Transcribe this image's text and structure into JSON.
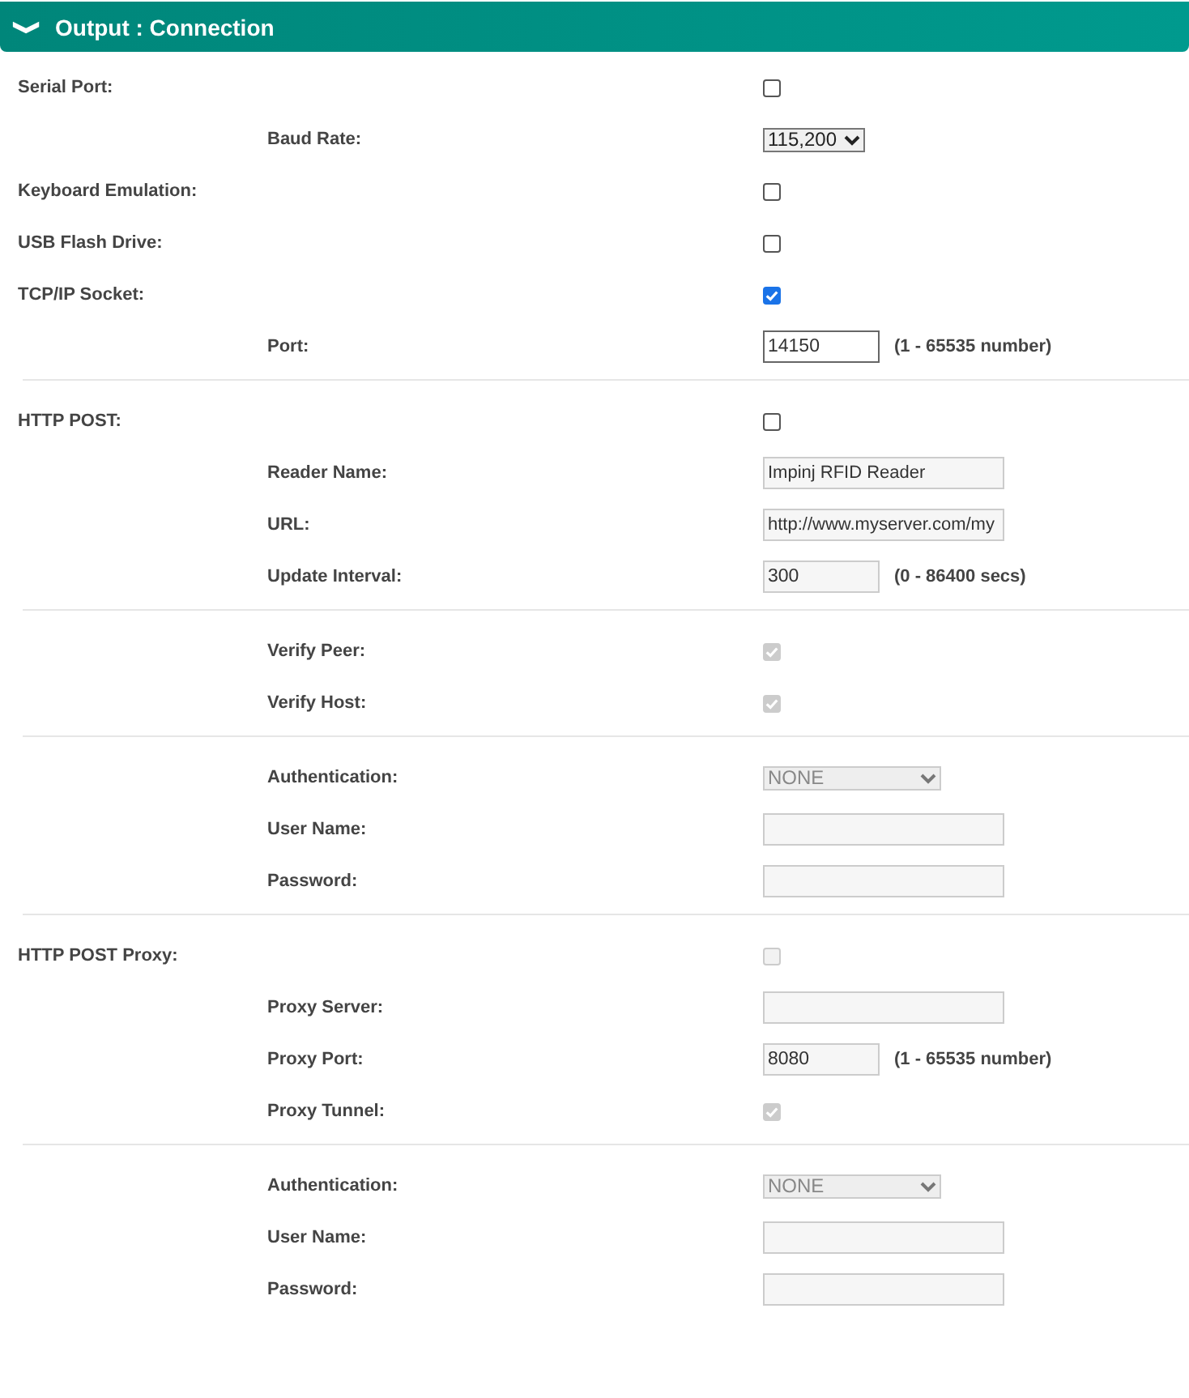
{
  "header": {
    "icon": "❯",
    "title": "Output : Connection",
    "expanded": true
  },
  "groups": [
    {
      "items": [
        {
          "label": "Serial Port:",
          "kind": "checkbox",
          "checked": false,
          "disabled": false,
          "children": [
            {
              "label": "Baud Rate:",
              "kind": "select",
              "value": "115,200",
              "disabled": false
            }
          ]
        },
        {
          "label": "Keyboard Emulation:",
          "kind": "checkbox",
          "checked": false,
          "disabled": false
        },
        {
          "label": "USB Flash Drive:",
          "kind": "checkbox",
          "checked": false,
          "disabled": false
        },
        {
          "label": "TCP/IP Socket:",
          "kind": "checkbox",
          "checked": true,
          "disabled": false,
          "children": [
            {
              "label": "Port:",
              "kind": "number",
              "value": "14150",
              "disabled": false,
              "hint": "(1 - 65535 number)"
            }
          ]
        }
      ]
    },
    {
      "items": [
        {
          "label": "HTTP POST:",
          "kind": "checkbox",
          "checked": false,
          "disabled": false,
          "children": [
            {
              "label": "Reader Name:",
              "kind": "text",
              "value": "Impinj RFID Reader",
              "disabled": true
            },
            {
              "label": "URL:",
              "kind": "text",
              "value": "http://www.myserver.com/my",
              "disabled": true
            },
            {
              "label": "Update Interval:",
              "kind": "number",
              "value": "300",
              "disabled": true,
              "hint": "(0 - 86400 secs)"
            }
          ]
        }
      ]
    },
    {
      "items": [
        {
          "children": [
            {
              "label": "Verify Peer:",
              "kind": "checkbox",
              "checked": true,
              "disabled": true
            },
            {
              "label": "Verify Host:",
              "kind": "checkbox",
              "checked": true,
              "disabled": true
            }
          ]
        }
      ]
    },
    {
      "items": [
        {
          "children": [
            {
              "label": "Authentication:",
              "kind": "select",
              "value": "NONE",
              "disabled": true
            },
            {
              "label": "User Name:",
              "kind": "text",
              "disabled": true
            },
            {
              "label": "Password:",
              "kind": "text",
              "disabled": true
            }
          ]
        }
      ]
    },
    {
      "items": [
        {
          "label": "HTTP POST Proxy:",
          "kind": "checkbox",
          "checked": false,
          "disabled": true,
          "children": [
            {
              "label": "Proxy Server:",
              "kind": "text",
              "disabled": true
            },
            {
              "label": "Proxy Port:",
              "kind": "number",
              "value": "8080",
              "disabled": true,
              "hint": "(1 - 65535 number)"
            },
            {
              "label": "Proxy Tunnel:",
              "kind": "checkbox",
              "checked": true,
              "disabled": true
            }
          ]
        }
      ]
    },
    {
      "items": [
        {
          "children": [
            {
              "label": "Authentication:",
              "kind": "select",
              "value": "NONE",
              "disabled": true
            },
            {
              "label": "User Name:",
              "kind": "text",
              "disabled": true
            },
            {
              "label": "Password:",
              "kind": "text",
              "disabled": true
            }
          ]
        }
      ]
    }
  ]
}
